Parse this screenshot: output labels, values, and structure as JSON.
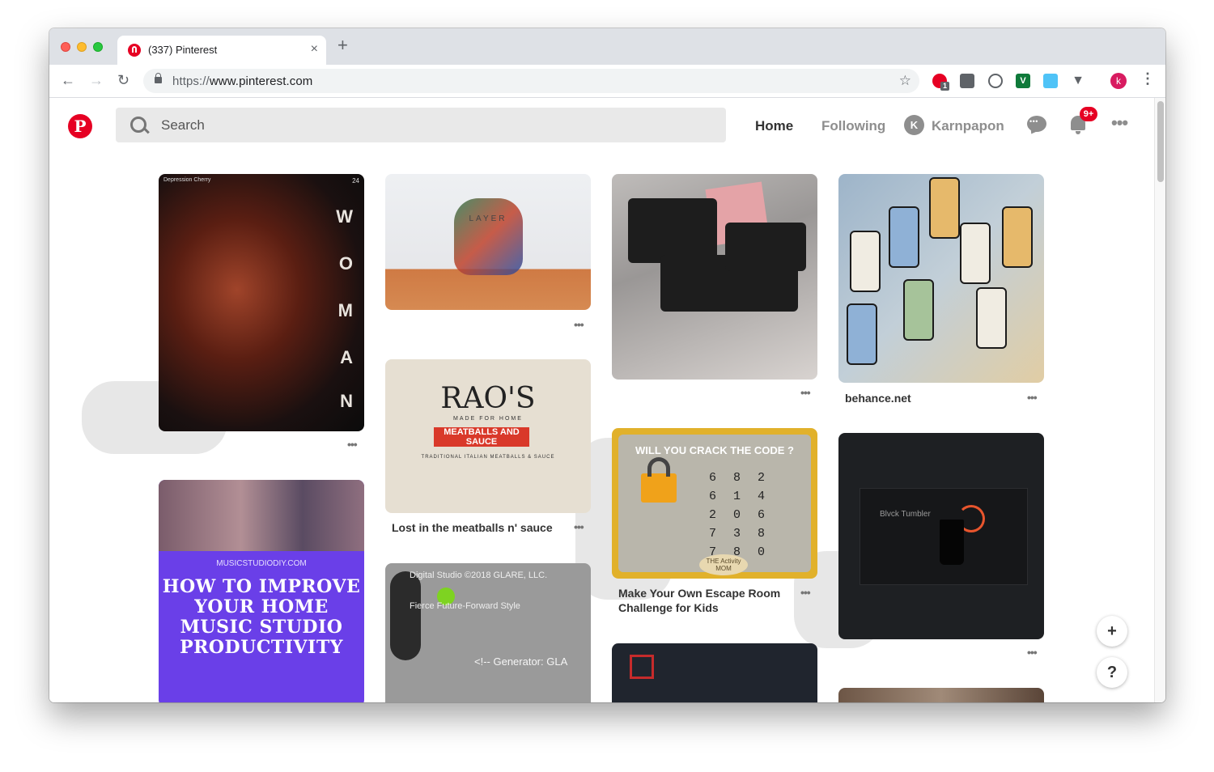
{
  "browser": {
    "tab_title": "(337) Pinterest",
    "tab_close": "×",
    "new_tab": "+",
    "url_scheme": "https://",
    "url_host": "www.pinterest.com",
    "back": "←",
    "forward": "→",
    "reload": "↻",
    "bookmark_star": "☆",
    "extension_badge": "1",
    "profile_initial": "k",
    "menu": "⋮"
  },
  "header": {
    "logo": "P",
    "search_placeholder": "Search",
    "nav": {
      "home": "Home",
      "following": "Following",
      "user_initial": "K",
      "user_name": "Karnpapon"
    },
    "notification_badge": "9+",
    "more": "•••"
  },
  "pins": [
    {
      "id": "pin1",
      "title": "",
      "text": {
        "tl": "Depression Cherry",
        "num": "24",
        "letters": [
          "W",
          "O",
          "M",
          "A",
          "N"
        ]
      }
    },
    {
      "id": "pin2",
      "title": "",
      "text": {
        "brand": "LAYER"
      }
    },
    {
      "id": "pin3",
      "title": "Lost in the meatballs n' sauce",
      "text": {
        "brand": "RAO'S",
        "sub": "MADE FOR HOME",
        "band": "MEATBALLS AND SAUCE",
        "desc": "TRADITIONAL ITALIAN MEATBALLS & SAUCE"
      }
    },
    {
      "id": "pin4",
      "title": ""
    },
    {
      "id": "pin5",
      "title": "Make Your Own Escape Room Challenge for Kids",
      "text": {
        "headline": "WILL YOU CRACK THE CODE ?",
        "codes": [
          "6 8 2",
          "6 1 4",
          "2 0 6",
          "7 3 8",
          "7 8 0"
        ],
        "brand": "THE Activity MOM"
      }
    },
    {
      "id": "pin6",
      "title": "behance.net"
    },
    {
      "id": "pin7",
      "title": "",
      "text": {
        "brand": "Blvck Tumbler"
      }
    },
    {
      "id": "pin8",
      "title": "",
      "text": {
        "site": "MUSICSTUDIODIY.COM",
        "headline": "HOW TO IMPROVE YOUR HOME MUSIC STUDIO PRODUCTIVITY"
      }
    },
    {
      "id": "pin9",
      "title": "",
      "text": {
        "studio": "Digital Studio ©2018 GLARE, LLC.",
        "tagline": "Fierce Future-Forward Style",
        "generator": "<!-- Generator: GLA"
      }
    },
    {
      "id": "pin10",
      "title": ""
    },
    {
      "id": "pin11",
      "title": ""
    }
  ],
  "pin_menu": "•••",
  "fabs": {
    "add": "+",
    "help": "?"
  },
  "colors": {
    "brand_red": "#e60023",
    "chrome_bg": "#dee1e6"
  }
}
